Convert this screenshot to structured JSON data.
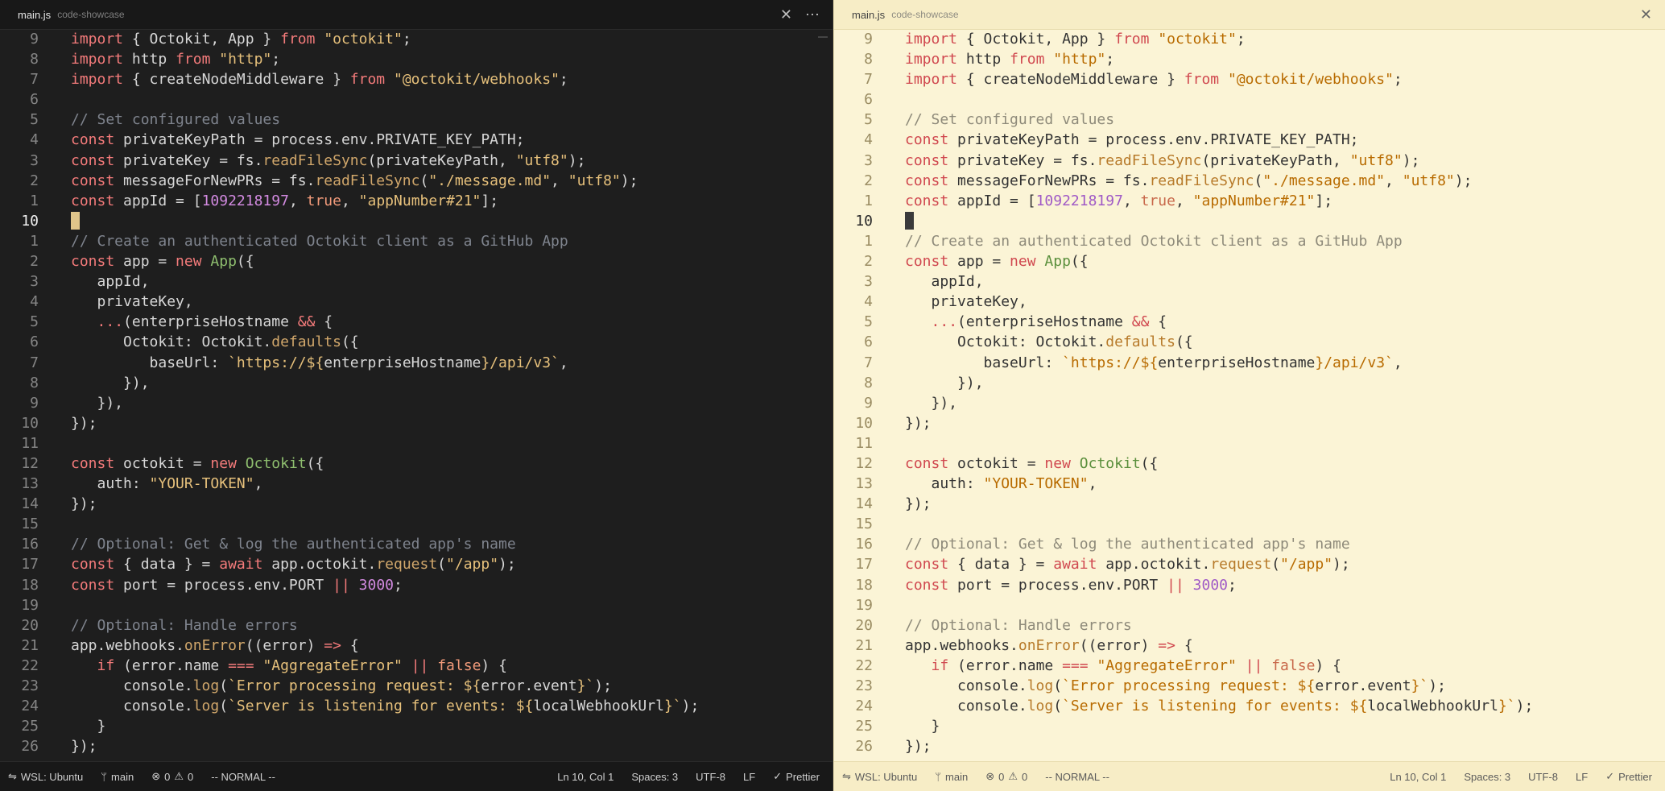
{
  "panes": [
    {
      "theme": "dark",
      "tab": {
        "file": "main.js",
        "folder": "code-showcase"
      },
      "status": {
        "remote": "WSL: Ubuntu",
        "branch": "main",
        "errors": "0",
        "warnings": "0",
        "mode": "-- NORMAL --",
        "position": "Ln 10, Col 1",
        "spaces": "Spaces: 3",
        "encoding": "UTF-8",
        "eol": "LF",
        "formatter": "Prettier"
      }
    },
    {
      "theme": "light",
      "tab": {
        "file": "main.js",
        "folder": "code-showcase"
      },
      "status": {
        "remote": "WSL: Ubuntu",
        "branch": "main",
        "errors": "0",
        "warnings": "0",
        "mode": "-- NORMAL --",
        "position": "Ln 10, Col 1",
        "spaces": "Spaces: 3",
        "encoding": "UTF-8",
        "eol": "LF",
        "formatter": "Prettier"
      }
    }
  ],
  "icons": {
    "close": "✕",
    "more": "⋯",
    "remote": "⇋",
    "branch": "ᛘ",
    "error": "⊗",
    "warning": "⚠",
    "check": "✓"
  },
  "active_line_index": 9,
  "lines": [
    {
      "n": "9",
      "tokens": [
        [
          "kw",
          "import"
        ],
        [
          "txt",
          " { Octokit, App } "
        ],
        [
          "kw",
          "from"
        ],
        [
          "txt",
          " "
        ],
        [
          "str",
          "\"octokit\""
        ],
        [
          "txt",
          ";"
        ]
      ]
    },
    {
      "n": "8",
      "tokens": [
        [
          "kw",
          "import"
        ],
        [
          "txt",
          " http "
        ],
        [
          "kw",
          "from"
        ],
        [
          "txt",
          " "
        ],
        [
          "str",
          "\"http\""
        ],
        [
          "txt",
          ";"
        ]
      ]
    },
    {
      "n": "7",
      "tokens": [
        [
          "kw",
          "import"
        ],
        [
          "txt",
          " { createNodeMiddleware } "
        ],
        [
          "kw",
          "from"
        ],
        [
          "txt",
          " "
        ],
        [
          "str",
          "\"@octokit/webhooks\""
        ],
        [
          "txt",
          ";"
        ]
      ]
    },
    {
      "n": "6",
      "tokens": []
    },
    {
      "n": "5",
      "tokens": [
        [
          "cm",
          "// Set configured values"
        ]
      ]
    },
    {
      "n": "4",
      "tokens": [
        [
          "kw",
          "const"
        ],
        [
          "txt",
          " privateKeyPath = process.env.PRIVATE_KEY_PATH;"
        ]
      ]
    },
    {
      "n": "3",
      "tokens": [
        [
          "kw",
          "const"
        ],
        [
          "txt",
          " privateKey = fs."
        ],
        [
          "fn",
          "readFileSync"
        ],
        [
          "txt",
          "(privateKeyPath, "
        ],
        [
          "str",
          "\"utf8\""
        ],
        [
          "txt",
          ");"
        ]
      ]
    },
    {
      "n": "2",
      "tokens": [
        [
          "kw",
          "const"
        ],
        [
          "txt",
          " messageForNewPRs = fs."
        ],
        [
          "fn",
          "readFileSync"
        ],
        [
          "txt",
          "("
        ],
        [
          "str",
          "\"./message.md\""
        ],
        [
          "txt",
          ", "
        ],
        [
          "str",
          "\"utf8\""
        ],
        [
          "txt",
          ");"
        ]
      ]
    },
    {
      "n": "1",
      "tokens": [
        [
          "kw",
          "const"
        ],
        [
          "txt",
          " appId = ["
        ],
        [
          "num",
          "1092218197"
        ],
        [
          "txt",
          ", "
        ],
        [
          "bool",
          "true"
        ],
        [
          "txt",
          ", "
        ],
        [
          "str",
          "\"appNumber#21\""
        ],
        [
          "txt",
          "];"
        ]
      ]
    },
    {
      "n": "10",
      "tokens": []
    },
    {
      "n": "1",
      "tokens": [
        [
          "cm",
          "// Create an authenticated Octokit client as a GitHub App"
        ]
      ]
    },
    {
      "n": "2",
      "tokens": [
        [
          "kw",
          "const"
        ],
        [
          "txt",
          " app = "
        ],
        [
          "kw",
          "new"
        ],
        [
          "txt",
          " "
        ],
        [
          "cls",
          "App"
        ],
        [
          "txt",
          "({"
        ]
      ]
    },
    {
      "n": "3",
      "tokens": [
        [
          "txt",
          "   appId,"
        ]
      ]
    },
    {
      "n": "4",
      "tokens": [
        [
          "txt",
          "   privateKey,"
        ]
      ]
    },
    {
      "n": "5",
      "tokens": [
        [
          "txt",
          "   "
        ],
        [
          "kw",
          "..."
        ],
        [
          "txt",
          "(enterpriseHostname "
        ],
        [
          "kw",
          "&&"
        ],
        [
          "txt",
          " {"
        ]
      ]
    },
    {
      "n": "6",
      "tokens": [
        [
          "txt",
          "      Octokit: Octokit."
        ],
        [
          "fn",
          "defaults"
        ],
        [
          "txt",
          "({"
        ]
      ]
    },
    {
      "n": "7",
      "tokens": [
        [
          "txt",
          "         baseUrl: "
        ],
        [
          "str",
          "`https://${"
        ],
        [
          "txt",
          "enterpriseHostname"
        ],
        [
          "str",
          "}/api/v3`"
        ],
        [
          "txt",
          ","
        ]
      ]
    },
    {
      "n": "8",
      "tokens": [
        [
          "txt",
          "      }),"
        ]
      ]
    },
    {
      "n": "9",
      "tokens": [
        [
          "txt",
          "   }),"
        ]
      ]
    },
    {
      "n": "10",
      "tokens": [
        [
          "txt",
          "});"
        ]
      ]
    },
    {
      "n": "11",
      "tokens": []
    },
    {
      "n": "12",
      "tokens": [
        [
          "kw",
          "const"
        ],
        [
          "txt",
          " octokit = "
        ],
        [
          "kw",
          "new"
        ],
        [
          "txt",
          " "
        ],
        [
          "cls",
          "Octokit"
        ],
        [
          "txt",
          "({"
        ]
      ]
    },
    {
      "n": "13",
      "tokens": [
        [
          "txt",
          "   auth: "
        ],
        [
          "str",
          "\"YOUR-TOKEN\""
        ],
        [
          "txt",
          ","
        ]
      ]
    },
    {
      "n": "14",
      "tokens": [
        [
          "txt",
          "});"
        ]
      ]
    },
    {
      "n": "15",
      "tokens": []
    },
    {
      "n": "16",
      "tokens": [
        [
          "cm",
          "// Optional: Get & log the authenticated app's name"
        ]
      ]
    },
    {
      "n": "17",
      "tokens": [
        [
          "kw",
          "const"
        ],
        [
          "txt",
          " { data } = "
        ],
        [
          "kw",
          "await"
        ],
        [
          "txt",
          " app.octokit."
        ],
        [
          "fn",
          "request"
        ],
        [
          "txt",
          "("
        ],
        [
          "str",
          "\"/app\""
        ],
        [
          "txt",
          ");"
        ]
      ]
    },
    {
      "n": "18",
      "tokens": [
        [
          "kw",
          "const"
        ],
        [
          "txt",
          " port = process.env.PORT "
        ],
        [
          "kw",
          "||"
        ],
        [
          "txt",
          " "
        ],
        [
          "num",
          "3000"
        ],
        [
          "txt",
          ";"
        ]
      ]
    },
    {
      "n": "19",
      "tokens": []
    },
    {
      "n": "20",
      "tokens": [
        [
          "cm",
          "// Optional: Handle errors"
        ]
      ]
    },
    {
      "n": "21",
      "tokens": [
        [
          "txt",
          "app.webhooks."
        ],
        [
          "fn",
          "onError"
        ],
        [
          "txt",
          "((error) "
        ],
        [
          "kw",
          "=>"
        ],
        [
          "txt",
          " {"
        ]
      ]
    },
    {
      "n": "22",
      "tokens": [
        [
          "txt",
          "   "
        ],
        [
          "kw",
          "if"
        ],
        [
          "txt",
          " (error.name "
        ],
        [
          "kw",
          "==="
        ],
        [
          "txt",
          " "
        ],
        [
          "str",
          "\"AggregateError\""
        ],
        [
          "txt",
          " "
        ],
        [
          "kw",
          "||"
        ],
        [
          "txt",
          " "
        ],
        [
          "bool",
          "false"
        ],
        [
          "txt",
          ") {"
        ]
      ]
    },
    {
      "n": "23",
      "tokens": [
        [
          "txt",
          "      console."
        ],
        [
          "fn",
          "log"
        ],
        [
          "txt",
          "("
        ],
        [
          "str",
          "`Error processing request: ${"
        ],
        [
          "txt",
          "error.event"
        ],
        [
          "str",
          "}`"
        ],
        [
          "txt",
          ");"
        ]
      ]
    },
    {
      "n": "24",
      "tokens": [
        [
          "txt",
          "      console."
        ],
        [
          "fn",
          "log"
        ],
        [
          "txt",
          "("
        ],
        [
          "str",
          "`Server is listening for events: ${"
        ],
        [
          "txt",
          "localWebhookUrl"
        ],
        [
          "str",
          "}`"
        ],
        [
          "txt",
          ");"
        ]
      ]
    },
    {
      "n": "25",
      "tokens": [
        [
          "txt",
          "   }"
        ]
      ]
    },
    {
      "n": "26",
      "tokens": [
        [
          "txt",
          "});"
        ]
      ]
    }
  ]
}
